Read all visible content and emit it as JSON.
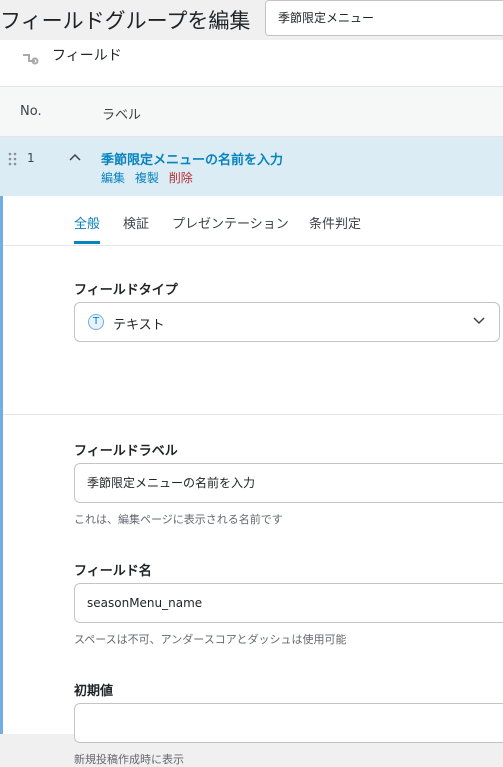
{
  "header": {
    "title": "フィールドグループを編集",
    "group_title_value": "季節限定メニュー"
  },
  "panel": {
    "title": "フィールド"
  },
  "table": {
    "col_no": "No.",
    "col_label": "ラベル"
  },
  "field_row": {
    "number": "1",
    "label": "季節限定メニューの名前を入力",
    "actions": {
      "edit": "編集",
      "duplicate": "複製",
      "delete": "削除"
    }
  },
  "tabs": [
    "全般",
    "検証",
    "プレゼンテーション",
    "条件判定"
  ],
  "active_tab": "全般",
  "settings": {
    "field_type": {
      "label": "フィールドタイプ",
      "value": "テキスト",
      "icon_glyph": "T"
    },
    "field_label": {
      "label": "フィールドラベル",
      "value": "季節限定メニューの名前を入力",
      "hint": "これは、編集ページに表示される名前です"
    },
    "field_name": {
      "label": "フィールド名",
      "value": "seasonMenu_name",
      "hint": "スペースは不可、アンダースコアとダッシュは使用可能"
    },
    "default_value": {
      "label": "初期値",
      "value": "",
      "hint": "新規投稿作成時に表示"
    }
  },
  "colors": {
    "accent": "#0783be",
    "delete": "#b32d2e",
    "row_highlight": "#dcecf5",
    "editor_border": "#72aee6"
  }
}
